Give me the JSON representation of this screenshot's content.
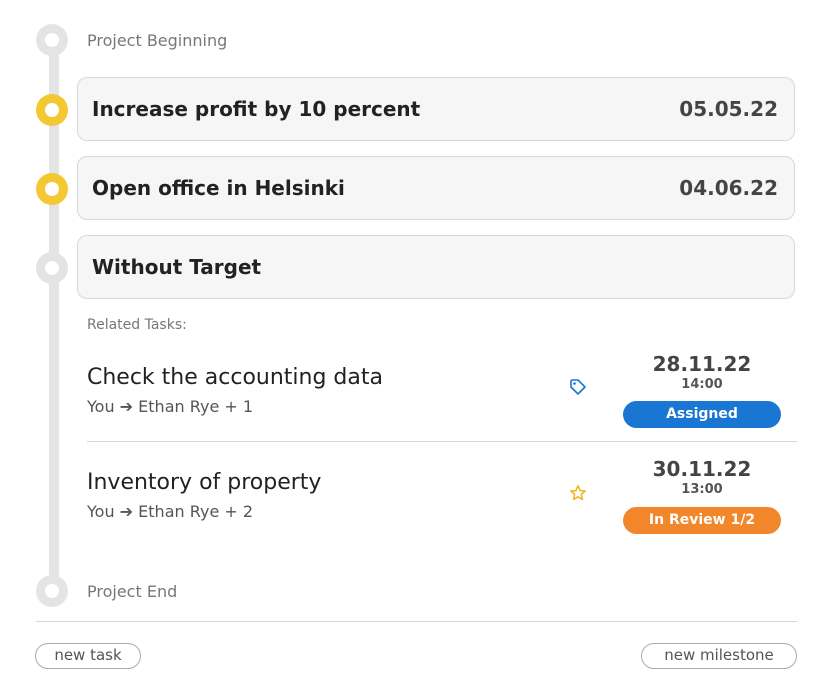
{
  "timeline": {
    "start_label": "Project Beginning",
    "end_label": "Project End"
  },
  "milestones": [
    {
      "title": "Increase profit by 10 percent",
      "date": "05.05.22",
      "status_color": "#f3c833"
    },
    {
      "title": "Open office in Helsinki",
      "date": "04.06.22",
      "status_color": "#f3c833"
    },
    {
      "title": "Without Target",
      "date": "",
      "status_color": "#e4e4e4"
    }
  ],
  "related_tasks_label": "Related Tasks:",
  "tasks": [
    {
      "title": "Check the accounting data",
      "from": "You",
      "arrow": "➔",
      "to": "Ethan Rye + 1",
      "icon": "tag-icon",
      "date": "28.11.22",
      "time": "14:00",
      "status": "Assigned",
      "status_color": "#1976d2"
    },
    {
      "title": "Inventory of property",
      "from": "You",
      "arrow": "➔",
      "to": "Ethan Rye + 2",
      "icon": "star-icon",
      "date": "30.11.22",
      "time": "13:00",
      "status": "In Review 1/2",
      "status_color": "#f2862b"
    }
  ],
  "actions": {
    "new_task": "new task",
    "new_milestone": "new milestone"
  }
}
